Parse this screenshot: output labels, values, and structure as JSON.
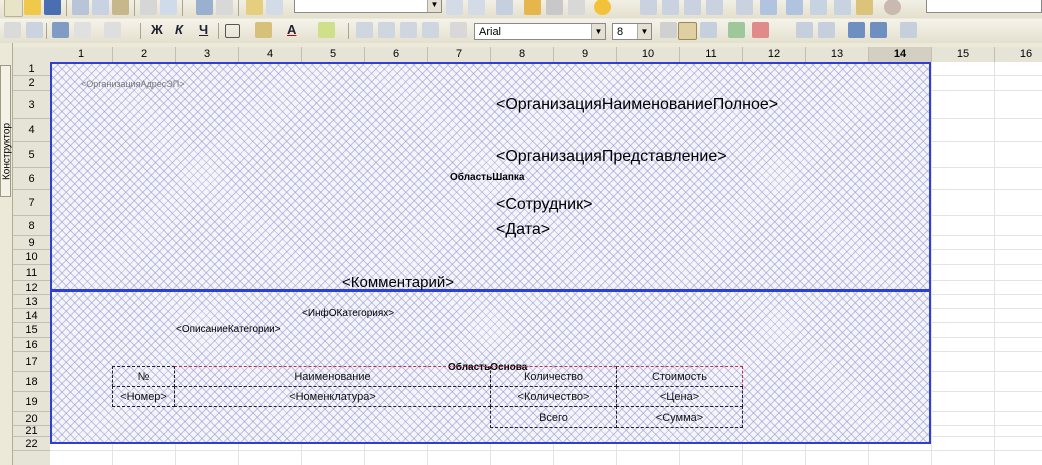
{
  "toolbar": {
    "font_name": "Arial",
    "font_size": "8",
    "bold_glyph": "Ж",
    "italic_glyph": "К",
    "underline_glyph": "Ч",
    "text_color_glyph": "A"
  },
  "sidebar": {
    "tab_label": "Конструктор"
  },
  "grid": {
    "columns": [
      "1",
      "2",
      "3",
      "4",
      "5",
      "6",
      "7",
      "8",
      "9",
      "10",
      "11",
      "12",
      "13",
      "14",
      "15",
      "16"
    ],
    "selected_column": "14",
    "rows": [
      "1",
      "2",
      "3",
      "4",
      "5",
      "6",
      "7",
      "8",
      "9",
      "10",
      "11",
      "12",
      "13",
      "14",
      "15",
      "16",
      "17",
      "18",
      "19",
      "20",
      "21",
      "22"
    ]
  },
  "areas": {
    "header": {
      "name": "ОбластьШапка",
      "org_address": "<ОрганизацияАдресЭП>",
      "org_full_name": "<ОрганизацияНаименованиеПолное>",
      "org_view": "<ОрганизацияПредставление>",
      "employee": "<Сотрудник>",
      "date": "<Дата>",
      "comment": "<Комментарий>"
    },
    "main": {
      "name": "ОбластьОснова",
      "category_info": "<ИнфОКатегориях>",
      "category_desc": "<ОписаниеКатегории>",
      "table": {
        "headers": [
          "№",
          "Наименование",
          "Количество",
          "Стоимость"
        ],
        "row": [
          "<Номер>",
          "<Номенклатура>",
          "<Количество>",
          "<Цена>"
        ],
        "total_label": "Всего",
        "total_value": "<Сумма>"
      }
    }
  },
  "colors": {
    "area_border": "#2f3fd6",
    "hatch": "#9696cd",
    "selected_border": "#c0304a"
  }
}
